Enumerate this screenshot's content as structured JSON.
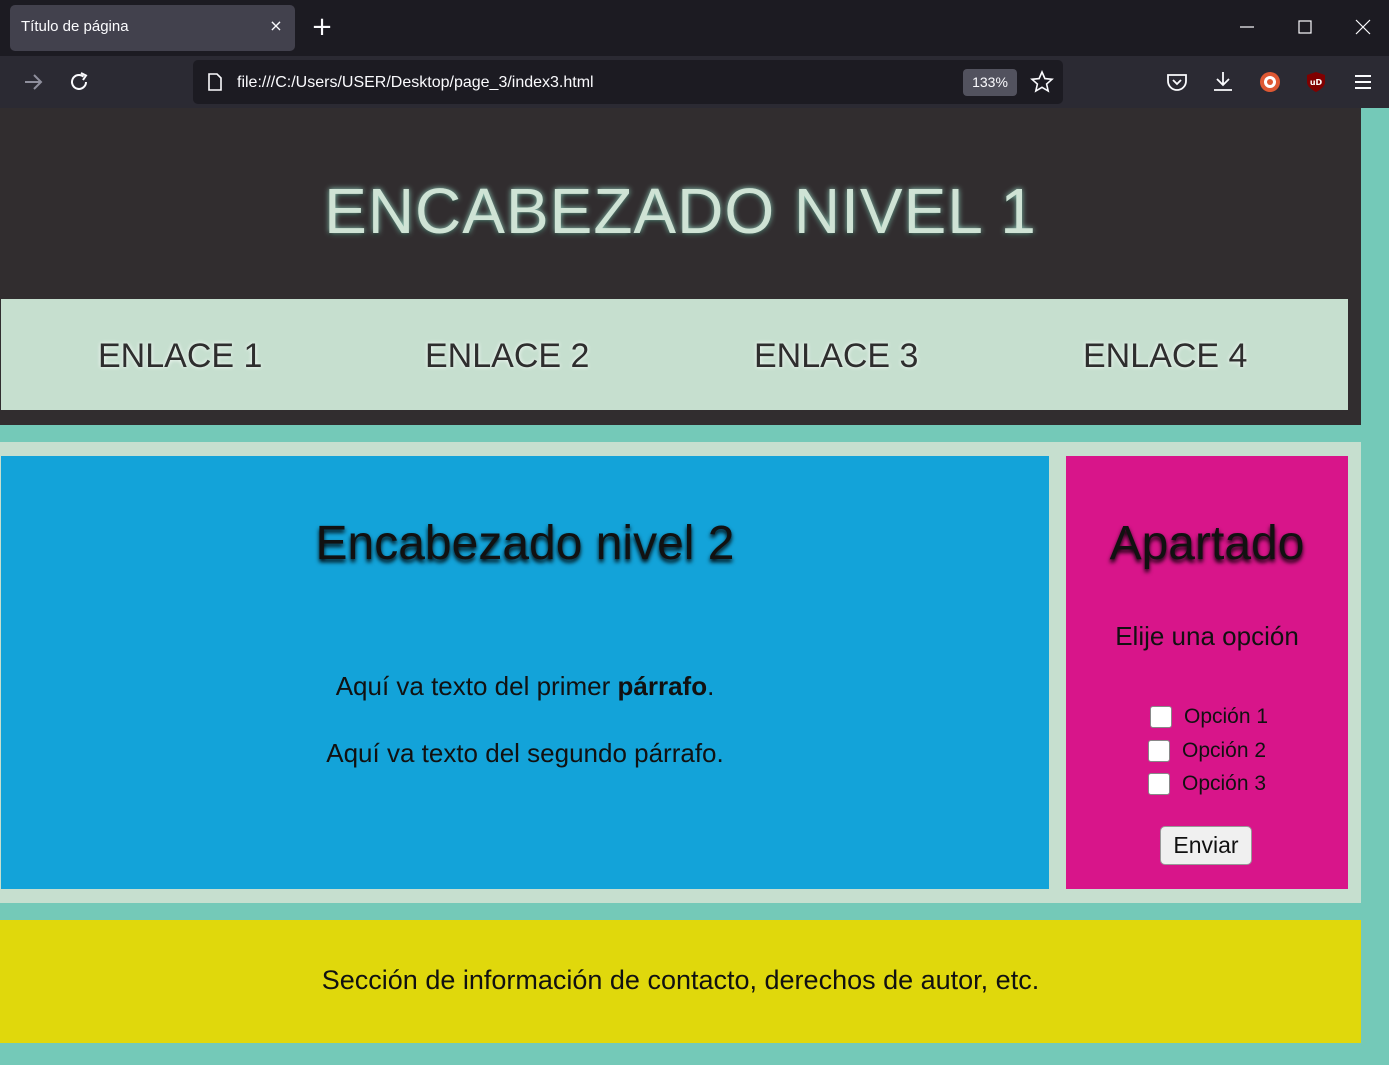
{
  "browser": {
    "tab_title": "Título de página",
    "tab_close": "×",
    "new_tab": "+",
    "url": "file:///C:/Users/USER/Desktop/page_3/index3.html",
    "zoom": "133%"
  },
  "header": {
    "title": "ENCABEZADO NIVEL 1"
  },
  "nav": {
    "links": [
      "ENLACE 1",
      "ENLACE 2",
      "ENLACE 3",
      "ENLACE 4"
    ]
  },
  "article": {
    "heading": "Encabezado nivel 2",
    "paragraph1_text": "Aquí va texto del primer ",
    "paragraph1_bold": "párrafo",
    "paragraph1_end": ".",
    "paragraph2": "Aquí va texto del segundo párrafo."
  },
  "aside": {
    "title": "Apartado",
    "prompt": "Elije una opción",
    "options": [
      "Opción 1",
      "Opción 2",
      "Opción 3"
    ],
    "submit_label": "Enviar"
  },
  "footer": {
    "text": "Sección de información de contacto, derechos de autor, etc."
  },
  "colors": {
    "page_bg": "#74c9b8",
    "header_bg": "#312d2f",
    "nav_bg": "#c6dfcf",
    "article_bg": "#13a3d9",
    "aside_bg": "#d8158a",
    "footer_bg": "#e0d80c"
  },
  "icons": {
    "toolbar_left": [
      "forward-arrow-icon",
      "reload-icon"
    ],
    "urlbar": [
      "page-icon",
      "bookmark-star-icon"
    ],
    "toolbar_right": [
      "pocket-icon",
      "downloads-icon",
      "duckduckgo-icon",
      "ublock-icon",
      "menu-icon"
    ],
    "window_controls": [
      "minimize-icon",
      "maximize-icon",
      "close-window-icon"
    ]
  }
}
